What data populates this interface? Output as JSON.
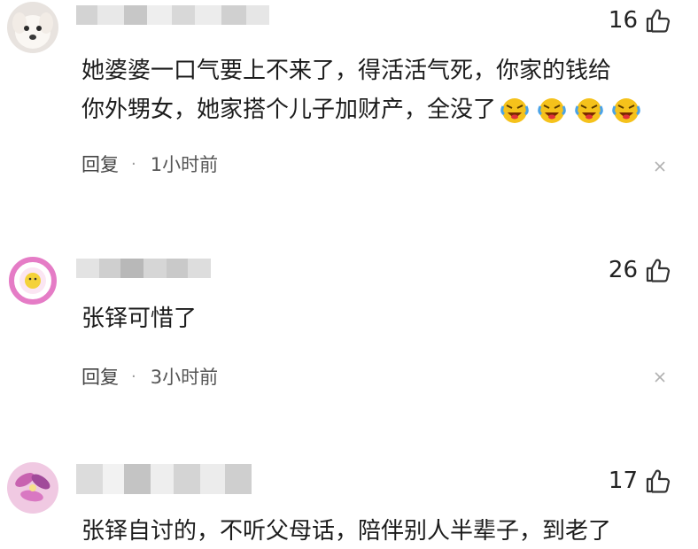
{
  "comments": [
    {
      "likes": "16",
      "text_lines": [
        "她婆婆一口气要上不来了，得活活气死，你家的钱给",
        "你外甥女，她家搭个儿子加财产，全没了"
      ],
      "emojis": [
        "crying-laughing-emoji",
        "crying-laughing-emoji",
        "crying-laughing-emoji",
        "crying-laughing-emoji"
      ],
      "reply_label": "回复",
      "separator": "·",
      "time": "1小时前"
    },
    {
      "likes": "26",
      "text_lines": [
        "张铎可惜了"
      ],
      "reply_label": "回复",
      "separator": "·",
      "time": "3小时前"
    },
    {
      "likes": "17",
      "text_lines": [
        "张铎自讨的，不听父母话，陪伴别人半辈子，到老了"
      ]
    }
  ],
  "colors": {
    "text": "#1c1c1c",
    "meta": "#555555",
    "thumb": "#333333",
    "emoji_face": "#f5c21b",
    "emoji_tongue": "#e0303a"
  }
}
